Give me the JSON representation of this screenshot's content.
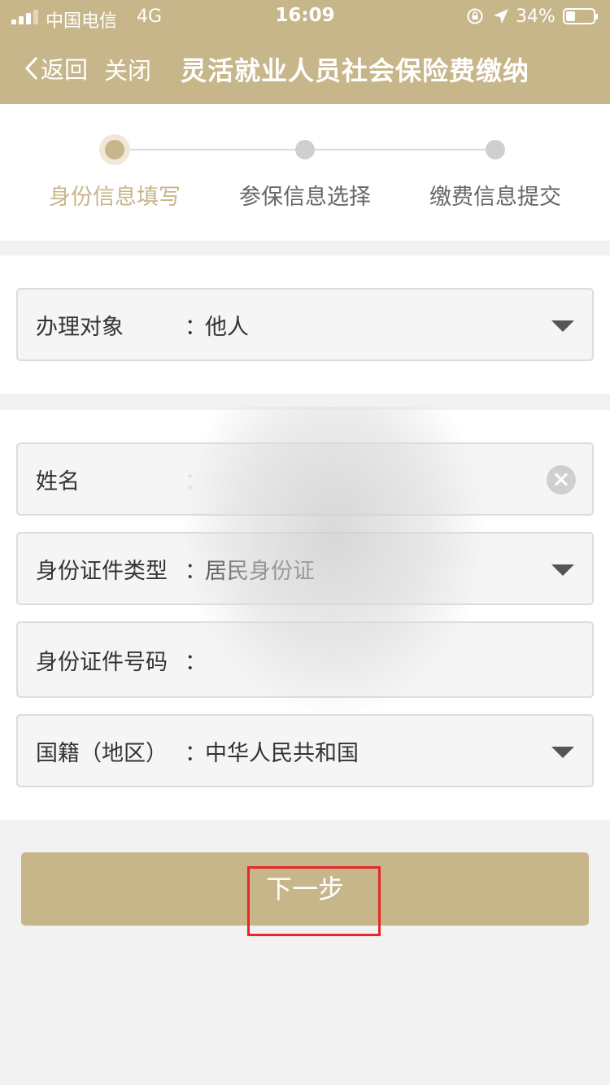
{
  "status_bar": {
    "carrier": "中国电信",
    "network": "4G",
    "time": "16:09",
    "battery": "34%"
  },
  "nav": {
    "back_label": "返回",
    "close_label": "关闭",
    "title": "灵活就业人员社会保险费缴纳"
  },
  "steps": [
    {
      "label": "身份信息填写",
      "active": true
    },
    {
      "label": "参保信息选择",
      "active": false
    },
    {
      "label": "缴费信息提交",
      "active": false
    }
  ],
  "form": {
    "colon": "：",
    "handle_target": {
      "label": "办理对象",
      "value": "他人"
    },
    "name": {
      "label": "姓名",
      "value": ""
    },
    "id_type": {
      "label": "身份证件类型",
      "value": "居民身份证"
    },
    "id_number": {
      "label": "身份证件号码",
      "value": ""
    },
    "nationality": {
      "label": "国籍（地区）",
      "value": "中华人民共和国"
    }
  },
  "next_button": {
    "label": "下一步"
  },
  "colors": {
    "accent": "#c7b68a",
    "highlight": "#e8262a"
  }
}
